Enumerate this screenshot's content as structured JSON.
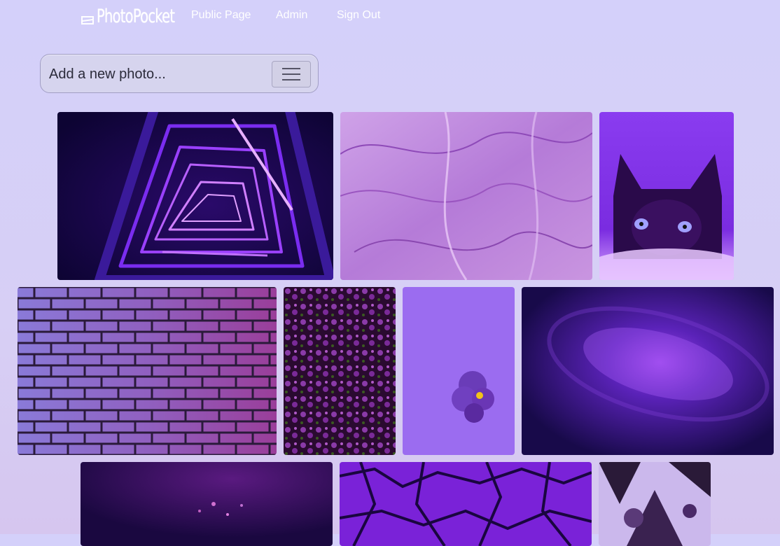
{
  "nav": {
    "brand": "PhotoPocket",
    "links": [
      "Public Page",
      "Admin",
      "Sign Out"
    ]
  },
  "uploader": {
    "placeholder": "Add a new photo...",
    "menu_icon": "hamburger-icon"
  },
  "gallery": {
    "photos": [
      {
        "name": "neon-triangle-staircase"
      },
      {
        "name": "crumpled-purple-tissue"
      },
      {
        "name": "cat-purple-light"
      },
      {
        "name": "purple-brick-wall"
      },
      {
        "name": "purple-flower-bush"
      },
      {
        "name": "single-pansy"
      },
      {
        "name": "purple-galaxy"
      },
      {
        "name": "dark-forest-glow"
      },
      {
        "name": "cracked-purple-glass"
      },
      {
        "name": "purple-leaves-sky"
      }
    ]
  },
  "colors": {
    "background": "#d4d0fa",
    "accent": "#7b2ff7"
  }
}
